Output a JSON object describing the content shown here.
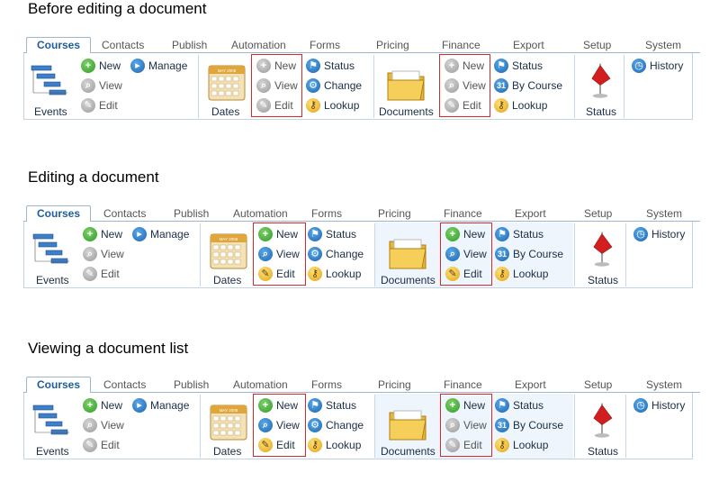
{
  "sections": [
    {
      "title": "Before editing a document",
      "tabs": [
        "Courses",
        "Contacts",
        "Publish",
        "Automation",
        "Forms",
        "Pricing",
        "Finance",
        "Export",
        "Setup",
        "System"
      ],
      "events": {
        "label": "Events",
        "new": "New",
        "view": "View",
        "edit": "Edit",
        "manage": "Manage"
      },
      "dates": {
        "label": "Dates",
        "cal_text": "MAY 2008",
        "new": "New",
        "view": "View",
        "edit": "Edit",
        "status": "Status",
        "change": "Change",
        "lookup": "Lookup"
      },
      "documents": {
        "label": "Documents",
        "new": "New",
        "view": "View",
        "edit": "Edit",
        "status": "Status",
        "by_course": "By Course",
        "lookup": "Lookup",
        "cal_num": "31"
      },
      "status": {
        "label": "Status"
      },
      "system": {
        "history": "History"
      }
    },
    {
      "title": "Editing a document",
      "tabs": [
        "Courses",
        "Contacts",
        "Publish",
        "Automation",
        "Forms",
        "Pricing",
        "Finance",
        "Export",
        "Setup",
        "System"
      ],
      "events": {
        "label": "Events",
        "new": "New",
        "view": "View",
        "edit": "Edit",
        "manage": "Manage"
      },
      "dates": {
        "label": "Dates",
        "cal_text": "MAY 2008",
        "new": "New",
        "view": "View",
        "edit": "Edit",
        "status": "Status",
        "change": "Change",
        "lookup": "Lookup"
      },
      "documents": {
        "label": "Documents",
        "new": "New",
        "view": "View",
        "edit": "Edit",
        "status": "Status",
        "by_course": "By Course",
        "lookup": "Lookup",
        "cal_num": "31"
      },
      "status": {
        "label": "Status"
      },
      "system": {
        "history": "History"
      }
    },
    {
      "title": "Viewing a document list",
      "tabs": [
        "Courses",
        "Contacts",
        "Publish",
        "Automation",
        "Forms",
        "Pricing",
        "Finance",
        "Export",
        "Setup",
        "System"
      ],
      "events": {
        "label": "Events",
        "new": "New",
        "view": "View",
        "edit": "Edit",
        "manage": "Manage"
      },
      "dates": {
        "label": "Dates",
        "cal_text": "MAY 2008",
        "new": "New",
        "view": "View",
        "edit": "Edit",
        "status": "Status",
        "change": "Change",
        "lookup": "Lookup"
      },
      "documents": {
        "label": "Documents",
        "new": "New",
        "view": "View",
        "edit": "Edit",
        "status": "Status",
        "by_course": "By Course",
        "lookup": "Lookup",
        "cal_num": "31"
      },
      "status": {
        "label": "Status"
      },
      "system": {
        "history": "History"
      }
    }
  ],
  "icons": {
    "new": "plus-circle-icon",
    "view": "magnifier-icon",
    "edit": "pencil-icon",
    "manage": "folder-arrow-icon",
    "status": "flag-icon",
    "change": "gear-icon",
    "lookup": "key-icon",
    "by_course": "calendar-31-icon",
    "history": "clock-icon",
    "events": "gantt-chart-icon",
    "dates": "calendar-icon",
    "documents": "folder-icon",
    "status_big": "red-flag-icon"
  },
  "colors": {
    "tab_active": "#1f5c99",
    "border": "#9fb6cf",
    "highlight_box": "#d32a2a",
    "group_highlight": "#eef5fc"
  }
}
